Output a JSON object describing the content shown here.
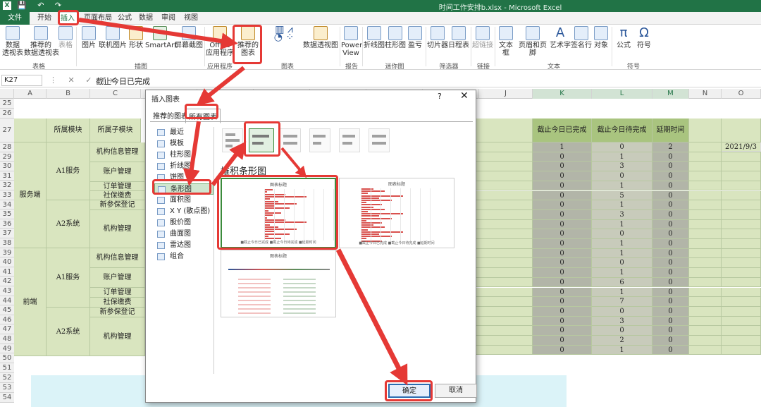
{
  "app": {
    "window_title": "时间工作安排b.xlsx - Microsoft Excel",
    "logo_letter": "X",
    "qat": "💾 ↶ ↷"
  },
  "menu": {
    "tabs": [
      "文件",
      "开始",
      "插入",
      "页面布局",
      "公式",
      "数据",
      "审阅",
      "视图"
    ],
    "active": "插入"
  },
  "ribbon": {
    "buttons": {
      "pivot": "数据\n透视表",
      "rec_pivot": "推荐的\n数据透视表",
      "table": "表格",
      "picture": "图片",
      "online_picture": "联机图片",
      "shapes": "形状",
      "smartart": "SmartArt",
      "screenshot": "屏幕截图",
      "office": "Office\n应用程序",
      "rec_chart": "推荐的\n图表",
      "pivot_chart": "数据透视图",
      "power_view": "Power\nView",
      "line": "折线图",
      "column": "柱形图",
      "winloss": "盈亏",
      "slicer": "切片器",
      "timeline": "日程表",
      "hyperlink": "超链接",
      "textbox": "文本框",
      "header_footer": "页眉和页脚",
      "wordart": "艺术字",
      "signature": "签名行",
      "object": "对象",
      "equation": "公式",
      "symbol": "符号"
    },
    "groups": {
      "tables": "表格",
      "illustrations": "插图",
      "apps": "应用程序",
      "charts": "图表",
      "reports": "报告",
      "sparklines": "迷你图",
      "filters": "筛选器",
      "links": "链接",
      "text": "文本",
      "symbols": "符号"
    }
  },
  "formula_bar": {
    "name_box": "K27",
    "icons": "⋮ ✕ ✓ fx",
    "value": "截止今日已完成"
  },
  "columns": [
    "A",
    "B",
    "C",
    "D",
    "E",
    "F",
    "G",
    "H",
    "I",
    "J",
    "K",
    "L",
    "M",
    "N",
    "O"
  ],
  "row_numbers": [
    "25",
    "26",
    "27",
    "28",
    "29",
    "30",
    "31",
    "32",
    "33",
    "34",
    "35",
    "36",
    "37",
    "38",
    "39",
    "40",
    "41",
    "42",
    "43",
    "44",
    "45",
    "46",
    "47",
    "48",
    "49",
    "50",
    "51",
    "52",
    "53",
    "54"
  ],
  "sheet": {
    "headers": {
      "module": "所属模块",
      "submodule": "所属子模块",
      "done": "截止今日已完成",
      "pending": "截止今日待完成",
      "delay": "延期时间"
    },
    "modules": [
      "服务端",
      "前端"
    ],
    "submodules": [
      "A1服务",
      "A2系统",
      "A1服务",
      "A2系统"
    ],
    "items": [
      "机构信息管理",
      "账户管理",
      "订单管理",
      "社保缴费",
      "新参保登记",
      "机构管理",
      "机构信息管理",
      "账户管理",
      "订单管理",
      "社保缴费",
      "新参保登记",
      "机构管理"
    ],
    "done_values": [
      "1",
      "0",
      "0",
      "0",
      "0",
      "0",
      "0",
      "0",
      "0",
      "0",
      "0",
      "0",
      "0",
      "0",
      "0",
      "0",
      "0",
      "0",
      "0",
      "0",
      "0",
      "0"
    ],
    "pending_values": [
      "0",
      "1",
      "3",
      "0",
      "1",
      "5",
      "1",
      "3",
      "1",
      "0",
      "1",
      "1",
      "0",
      "1",
      "6",
      "1",
      "7",
      "0",
      "3",
      "0",
      "2",
      "1",
      "0"
    ],
    "delay_values": [
      "2",
      "0",
      "0",
      "0",
      "0",
      "0",
      "0",
      "0",
      "0",
      "0",
      "0",
      "0",
      "0",
      "0",
      "0",
      "0",
      "0",
      "0",
      "0",
      "0",
      "0",
      "0"
    ],
    "date": "2021/9/3"
  },
  "dialog": {
    "title": "插入图表",
    "help": "?",
    "close": "✕",
    "tab_recommended": "推荐的图表",
    "tab_all": "所有图表",
    "categories": [
      "最近",
      "模板",
      "柱形图",
      "折线图",
      "饼图",
      "条形图",
      "面积图",
      "X Y (散点图)",
      "股价图",
      "曲面图",
      "雷达图",
      "组合"
    ],
    "selected_category": "条形图",
    "subtype_title": "堆积条形图",
    "preview_title": "图表标题",
    "legend": "■截止今日已完成 ■截止今日待完成 ■延期时间",
    "ok": "确定",
    "cancel": "取消"
  },
  "colors": {
    "excel_green": "#217346",
    "header_green": "#a9c47f",
    "light_green": "#d9e5bf",
    "gray": "#b2b5a8",
    "highlight_red": "#e53935",
    "bar_red": "#d9514e"
  }
}
